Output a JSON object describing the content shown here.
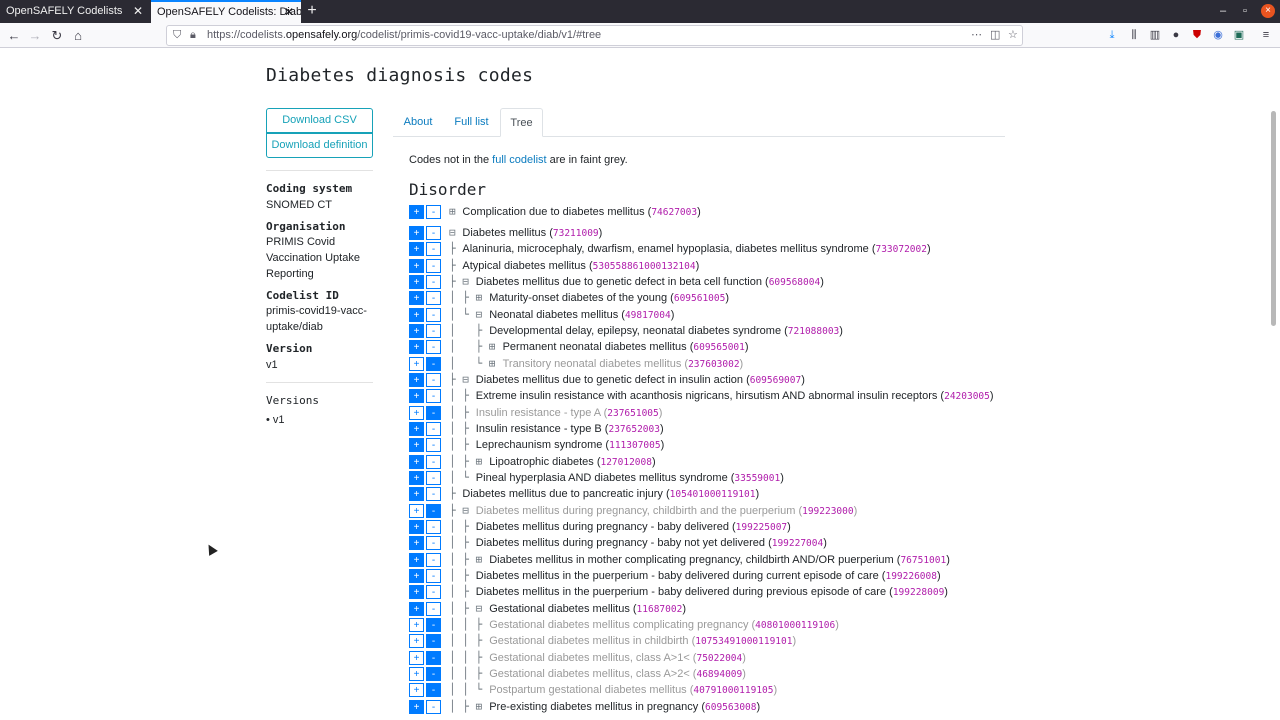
{
  "browser": {
    "tabs": [
      {
        "title": "OpenSAFELY Codelists",
        "close": "✕"
      },
      {
        "title": "OpenSAFELY Codelists: Diab",
        "close": "✕"
      }
    ],
    "new_tab": "+",
    "url_prefix": "https://codelists.",
    "url_domain": "opensafely.org",
    "url_path": "/codelist/primis-covid19-vacc-uptake/diab/v1/#tree",
    "win_minimize": "–",
    "win_maximize": "▫",
    "win_close": "×"
  },
  "page": {
    "title": "Diabetes diagnosis codes",
    "download_csv": "Download CSV",
    "download_definition": "Download definition",
    "coding_system_label": "Coding system",
    "coding_system_value": "SNOMED CT",
    "organisation_label": "Organisation",
    "organisation_value": "PRIMIS Covid Vaccination Uptake Reporting",
    "codelist_id_label": "Codelist ID",
    "codelist_id_value": "primis-covid19-vacc-uptake/diab",
    "version_label": "Version",
    "version_value": "v1",
    "versions_label": "Versions",
    "versions": [
      "v1"
    ],
    "tabs": [
      "About",
      "Full list",
      "Tree"
    ],
    "note_before": "Codes not in the ",
    "note_link": "full codelist",
    "note_after": " are in faint grey.",
    "section_title": "Disorder"
  },
  "tree": [
    {
      "plus": true,
      "minus": false,
      "prefix": "",
      "toggle": "⊞",
      "indent": 0,
      "term": "Complication due to diabetes mellitus",
      "code": "74627003",
      "faint": false
    },
    {
      "plus": true,
      "minus": false,
      "prefix": "",
      "toggle": "⊟",
      "indent": 0,
      "term": "Diabetes mellitus",
      "code": "73211009",
      "faint": false
    },
    {
      "plus": true,
      "minus": false,
      "prefix": "├ ",
      "toggle": "",
      "indent": 0,
      "term": "Alaninuria, microcephaly, dwarfism, enamel hypoplasia, diabetes mellitus syndrome",
      "code": "733072002",
      "faint": false
    },
    {
      "plus": true,
      "minus": false,
      "prefix": "├ ",
      "toggle": "",
      "indent": 0,
      "term": "Atypical diabetes mellitus",
      "code": "530558861000132104",
      "faint": false
    },
    {
      "plus": true,
      "minus": false,
      "prefix": "├ ",
      "toggle": "⊟",
      "indent": 0,
      "term": "Diabetes mellitus due to genetic defect in beta cell function",
      "code": "609568004",
      "faint": false
    },
    {
      "plus": true,
      "minus": false,
      "prefix": "│ ├ ",
      "toggle": "⊞",
      "indent": 1,
      "term": "Maturity-onset diabetes of the young",
      "code": "609561005",
      "faint": false
    },
    {
      "plus": true,
      "minus": false,
      "prefix": "│ └ ",
      "toggle": "⊟",
      "indent": 1,
      "term": "Neonatal diabetes mellitus",
      "code": "49817004",
      "faint": false
    },
    {
      "plus": true,
      "minus": false,
      "prefix": "│   ├ ",
      "toggle": "",
      "indent": 2,
      "term": "Developmental delay, epilepsy, neonatal diabetes syndrome",
      "code": "721088003",
      "faint": false
    },
    {
      "plus": true,
      "minus": false,
      "prefix": "│   ├ ",
      "toggle": "⊞",
      "indent": 2,
      "term": "Permanent neonatal diabetes mellitus",
      "code": "609565001",
      "faint": false
    },
    {
      "plus": false,
      "minus": true,
      "prefix": "│   └ ",
      "toggle": "⊞",
      "indent": 2,
      "term": "Transitory neonatal diabetes mellitus",
      "code": "237603002",
      "faint": true
    },
    {
      "plus": true,
      "minus": false,
      "prefix": "├ ",
      "toggle": "⊟",
      "indent": 0,
      "term": "Diabetes mellitus due to genetic defect in insulin action",
      "code": "609569007",
      "faint": false
    },
    {
      "plus": true,
      "minus": false,
      "prefix": "│ ├ ",
      "toggle": "",
      "indent": 1,
      "term": "Extreme insulin resistance with acanthosis nigricans, hirsutism AND abnormal insulin receptors",
      "code": "24203005",
      "faint": false
    },
    {
      "plus": false,
      "minus": true,
      "prefix": "│ ├ ",
      "toggle": "",
      "indent": 1,
      "term": "Insulin resistance - type A",
      "code": "237651005",
      "faint": true
    },
    {
      "plus": true,
      "minus": false,
      "prefix": "│ ├ ",
      "toggle": "",
      "indent": 1,
      "term": "Insulin resistance - type B",
      "code": "237652003",
      "faint": false
    },
    {
      "plus": true,
      "minus": false,
      "prefix": "│ ├ ",
      "toggle": "",
      "indent": 1,
      "term": "Leprechaunism syndrome",
      "code": "111307005",
      "faint": false
    },
    {
      "plus": true,
      "minus": false,
      "prefix": "│ ├ ",
      "toggle": "⊞",
      "indent": 1,
      "term": "Lipoatrophic diabetes",
      "code": "127012008",
      "faint": false
    },
    {
      "plus": true,
      "minus": false,
      "prefix": "│ └ ",
      "toggle": "",
      "indent": 1,
      "term": "Pineal hyperplasia AND diabetes mellitus syndrome",
      "code": "33559001",
      "faint": false
    },
    {
      "plus": true,
      "minus": false,
      "prefix": "├ ",
      "toggle": "",
      "indent": 0,
      "term": "Diabetes mellitus due to pancreatic injury",
      "code": "105401000119101",
      "faint": false
    },
    {
      "plus": false,
      "minus": true,
      "prefix": "├ ",
      "toggle": "⊟",
      "indent": 0,
      "term": "Diabetes mellitus during pregnancy, childbirth and the puerperium",
      "code": "199223000",
      "faint": true
    },
    {
      "plus": true,
      "minus": false,
      "prefix": "│ ├ ",
      "toggle": "",
      "indent": 1,
      "term": "Diabetes mellitus during pregnancy - baby delivered",
      "code": "199225007",
      "faint": false
    },
    {
      "plus": true,
      "minus": false,
      "prefix": "│ ├ ",
      "toggle": "",
      "indent": 1,
      "term": "Diabetes mellitus during pregnancy - baby not yet delivered",
      "code": "199227004",
      "faint": false
    },
    {
      "plus": true,
      "minus": false,
      "prefix": "│ ├ ",
      "toggle": "⊞",
      "indent": 1,
      "term": "Diabetes mellitus in mother complicating pregnancy, childbirth AND/OR puerperium",
      "code": "76751001",
      "faint": false
    },
    {
      "plus": true,
      "minus": false,
      "prefix": "│ ├ ",
      "toggle": "",
      "indent": 1,
      "term": "Diabetes mellitus in the puerperium - baby delivered during current episode of care",
      "code": "199226008",
      "faint": false
    },
    {
      "plus": true,
      "minus": false,
      "prefix": "│ ├ ",
      "toggle": "",
      "indent": 1,
      "term": "Diabetes mellitus in the puerperium - baby delivered during previous episode of care",
      "code": "199228009",
      "faint": false
    },
    {
      "plus": true,
      "minus": false,
      "prefix": "│ ├ ",
      "toggle": "⊟",
      "indent": 1,
      "term": "Gestational diabetes mellitus",
      "code": "11687002",
      "faint": false
    },
    {
      "plus": false,
      "minus": true,
      "prefix": "│ │ ├ ",
      "toggle": "",
      "indent": 2,
      "term": "Gestational diabetes mellitus complicating pregnancy",
      "code": "40801000119106",
      "faint": true
    },
    {
      "plus": false,
      "minus": true,
      "prefix": "│ │ ├ ",
      "toggle": "",
      "indent": 2,
      "term": "Gestational diabetes mellitus in childbirth",
      "code": "10753491000119101",
      "faint": true
    },
    {
      "plus": false,
      "minus": true,
      "prefix": "│ │ ├ ",
      "toggle": "",
      "indent": 2,
      "term": "Gestational diabetes mellitus, class A>1<",
      "code": "75022004",
      "faint": true
    },
    {
      "plus": false,
      "minus": true,
      "prefix": "│ │ ├ ",
      "toggle": "",
      "indent": 2,
      "term": "Gestational diabetes mellitus, class A>2<",
      "code": "46894009",
      "faint": true
    },
    {
      "plus": false,
      "minus": true,
      "prefix": "│ │ └ ",
      "toggle": "",
      "indent": 2,
      "term": "Postpartum gestational diabetes mellitus",
      "code": "40791000119105",
      "faint": true
    },
    {
      "plus": true,
      "minus": false,
      "prefix": "│ ├ ",
      "toggle": "⊞",
      "indent": 1,
      "term": "Pre-existing diabetes mellitus in pregnancy",
      "code": "609563008",
      "faint": false
    }
  ]
}
